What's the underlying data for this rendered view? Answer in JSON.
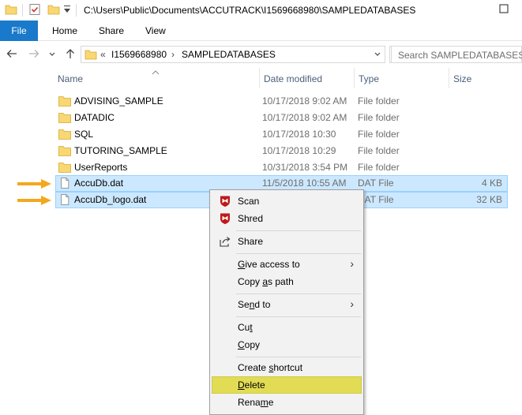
{
  "window": {
    "title": "C:\\Users\\Public\\Documents\\ACCUTRACK\\I1569668980\\SAMPLEDATABASES"
  },
  "ribbon": {
    "file": "File",
    "home": "Home",
    "share": "Share",
    "view": "View"
  },
  "address": {
    "overflow": "«",
    "crumb1": "I1569668980",
    "crumb_sep": "›",
    "crumb2": "SAMPLEDATABASES"
  },
  "search": {
    "placeholder": "Search SAMPLEDATABASES"
  },
  "columns": {
    "name": "Name",
    "date": "Date modified",
    "type": "Type",
    "size": "Size"
  },
  "files": [
    {
      "name": "ADVISING_SAMPLE",
      "date": "10/17/2018 9:02 AM",
      "type": "File folder",
      "size": "",
      "kind": "folder",
      "selected": false
    },
    {
      "name": "DATADIC",
      "date": "10/17/2018 9:02 AM",
      "type": "File folder",
      "size": "",
      "kind": "folder",
      "selected": false
    },
    {
      "name": "SQL",
      "date": "10/17/2018 10:30",
      "type": "File folder",
      "size": "",
      "kind": "folder",
      "selected": false
    },
    {
      "name": "TUTORING_SAMPLE",
      "date": "10/17/2018 10:29",
      "type": "File folder",
      "size": "",
      "kind": "folder",
      "selected": false
    },
    {
      "name": "UserReports",
      "date": "10/31/2018 3:54 PM",
      "type": "File folder",
      "size": "",
      "kind": "folder",
      "selected": false
    },
    {
      "name": "AccuDb.dat",
      "date": "11/5/2018 10:55 AM",
      "type": "DAT File",
      "size": "4 KB",
      "kind": "file",
      "selected": true
    },
    {
      "name": "AccuDb_logo.dat",
      "date": "",
      "type": "DAT File",
      "size": "32 KB",
      "kind": "file",
      "selected": true
    }
  ],
  "context_menu": {
    "scan": "Scan",
    "shred": "Shred",
    "share": "Share",
    "give_access_pre": "",
    "give_access_u": "G",
    "give_access_post": "ive access to",
    "copy_path_pre": "Copy ",
    "copy_path_u": "a",
    "copy_path_post": "s path",
    "send_to_pre": "Se",
    "send_to_u": "n",
    "send_to_post": "d to",
    "cut_pre": "Cu",
    "cut_u": "t",
    "cut_post": "",
    "copy_pre": "",
    "copy_u": "C",
    "copy_post": "opy",
    "create_shortcut_pre": "Create ",
    "create_shortcut_u": "s",
    "create_shortcut_post": "hortcut",
    "delete_pre": "",
    "delete_u": "D",
    "delete_post": "elete",
    "rename_pre": "Rena",
    "rename_u": "m",
    "rename_post": "e"
  },
  "colors": {
    "accent": "#1979ca",
    "selection": "#cce8ff",
    "highlight": "#e2dc55",
    "arrow": "#f4a81d",
    "mcafee": "#c01818"
  }
}
